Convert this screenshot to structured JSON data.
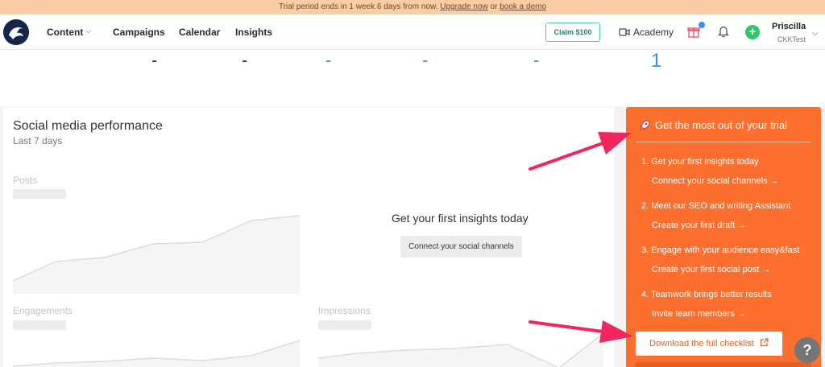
{
  "banner": {
    "text": "Trial period ends in 1 week 6 days from now.",
    "upgrade_link": "Upgrade now",
    "or": "or",
    "demo_link": "book a demo"
  },
  "nav": {
    "content": "Content",
    "campaigns": "Campaigns",
    "calendar": "Calendar",
    "insights": "Insights",
    "claim": "Claim $100",
    "academy": "Academy",
    "plus": "+",
    "user_name": "Priscilla",
    "user_org": "CKKTest"
  },
  "stats": {
    "s1": "-",
    "s2": "-",
    "s3": "-",
    "s4": "-",
    "s5": "-",
    "s6": "1"
  },
  "performance": {
    "title": "Social media performance",
    "subtitle": "Last 7 days",
    "posts_label": "Posts",
    "engagements_label": "Engagements",
    "impressions_label": "Impressions",
    "empty_title": "Get your first insights today",
    "empty_button": "Connect your social channels"
  },
  "trial_panel": {
    "title": "Get the most out of your trial",
    "steps": [
      {
        "title": "1. Get your first insights today",
        "link": "Connect your social channels →"
      },
      {
        "title": "2. Meet our SEO and writing Assistant",
        "link": "Create your first draft →"
      },
      {
        "title": "3. Engage with your audience easy&fast",
        "link": "Create your first social post →"
      },
      {
        "title": "4. Teamwork brings better results",
        "link": "Invite team members →"
      }
    ],
    "checklist_button": "Download the full checklist"
  },
  "help": "?",
  "colors": {
    "accent_orange": "#fd6f2e",
    "arrow_pink": "#f0275f",
    "stat_blue": "#3d8fe0",
    "claim_border": "#4fc7b4"
  }
}
